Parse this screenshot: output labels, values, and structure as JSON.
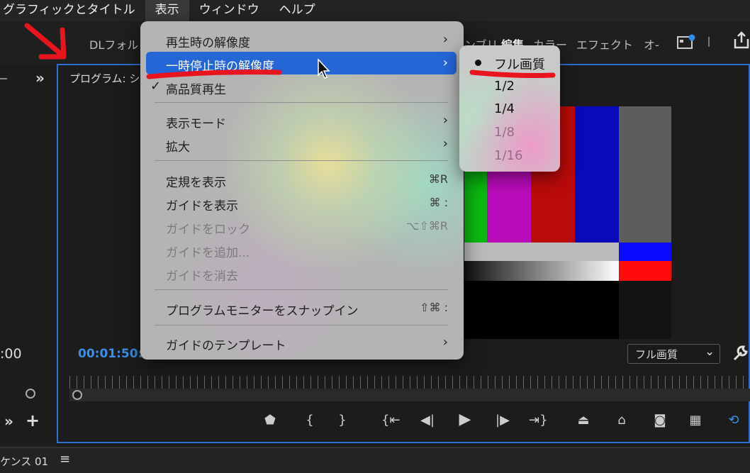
{
  "menubar": {
    "items": [
      "グラフィックとタイトル",
      "表示",
      "ウィンドウ",
      "ヘルプ"
    ],
    "active_index": 1
  },
  "workspace": {
    "dl_label": "DLフォル",
    "assembly_fragment": "ンブリ",
    "edit": "編集",
    "color": "カラー",
    "effects": "エフェクト",
    "audio_fragment": "オ-"
  },
  "monitor": {
    "panel_title": "プログラム: シ",
    "timecode": "00:01:50:",
    "left_timecode": ":00",
    "resolution_select": "フル画質",
    "panel_expand": "»"
  },
  "view_menu": {
    "items": [
      {
        "label": "再生時の解像度",
        "submenu": true
      },
      {
        "label": "一時停止時の解像度",
        "submenu": true,
        "highlighted": true
      },
      {
        "label": "高品質再生",
        "checked": true
      },
      {
        "label": "表示モード",
        "submenu": true
      },
      {
        "label": "拡大",
        "submenu": true
      },
      {
        "label": "定規を表示",
        "shortcut": "⌘R"
      },
      {
        "label": "ガイドを表示",
        "shortcut": "⌘ :"
      },
      {
        "label": "ガイドをロック",
        "shortcut": "⌥⇧⌘R",
        "disabled": true
      },
      {
        "label": "ガイドを追加...",
        "disabled": true
      },
      {
        "label": "ガイドを消去",
        "disabled": true
      },
      {
        "label": "プログラムモニターをスナップイン",
        "shortcut": "⇧⌘ :"
      },
      {
        "label": "ガイドのテンプレート",
        "submenu": true
      }
    ],
    "arrow": "›",
    "check": "✓"
  },
  "resolution_submenu": {
    "items": [
      {
        "label": "フル画質",
        "selected": true
      },
      {
        "label": "1/2"
      },
      {
        "label": "1/4"
      },
      {
        "label": "1/8",
        "disabled": true
      },
      {
        "label": "1/16",
        "disabled": true
      }
    ]
  },
  "bottom": {
    "sequence_label": "ケンス 01",
    "menu_icon": "≡"
  },
  "colors": {
    "accent_blue": "#2566d6",
    "annotation_red": "#e8141e",
    "timecode_blue": "#3d8fe6"
  }
}
